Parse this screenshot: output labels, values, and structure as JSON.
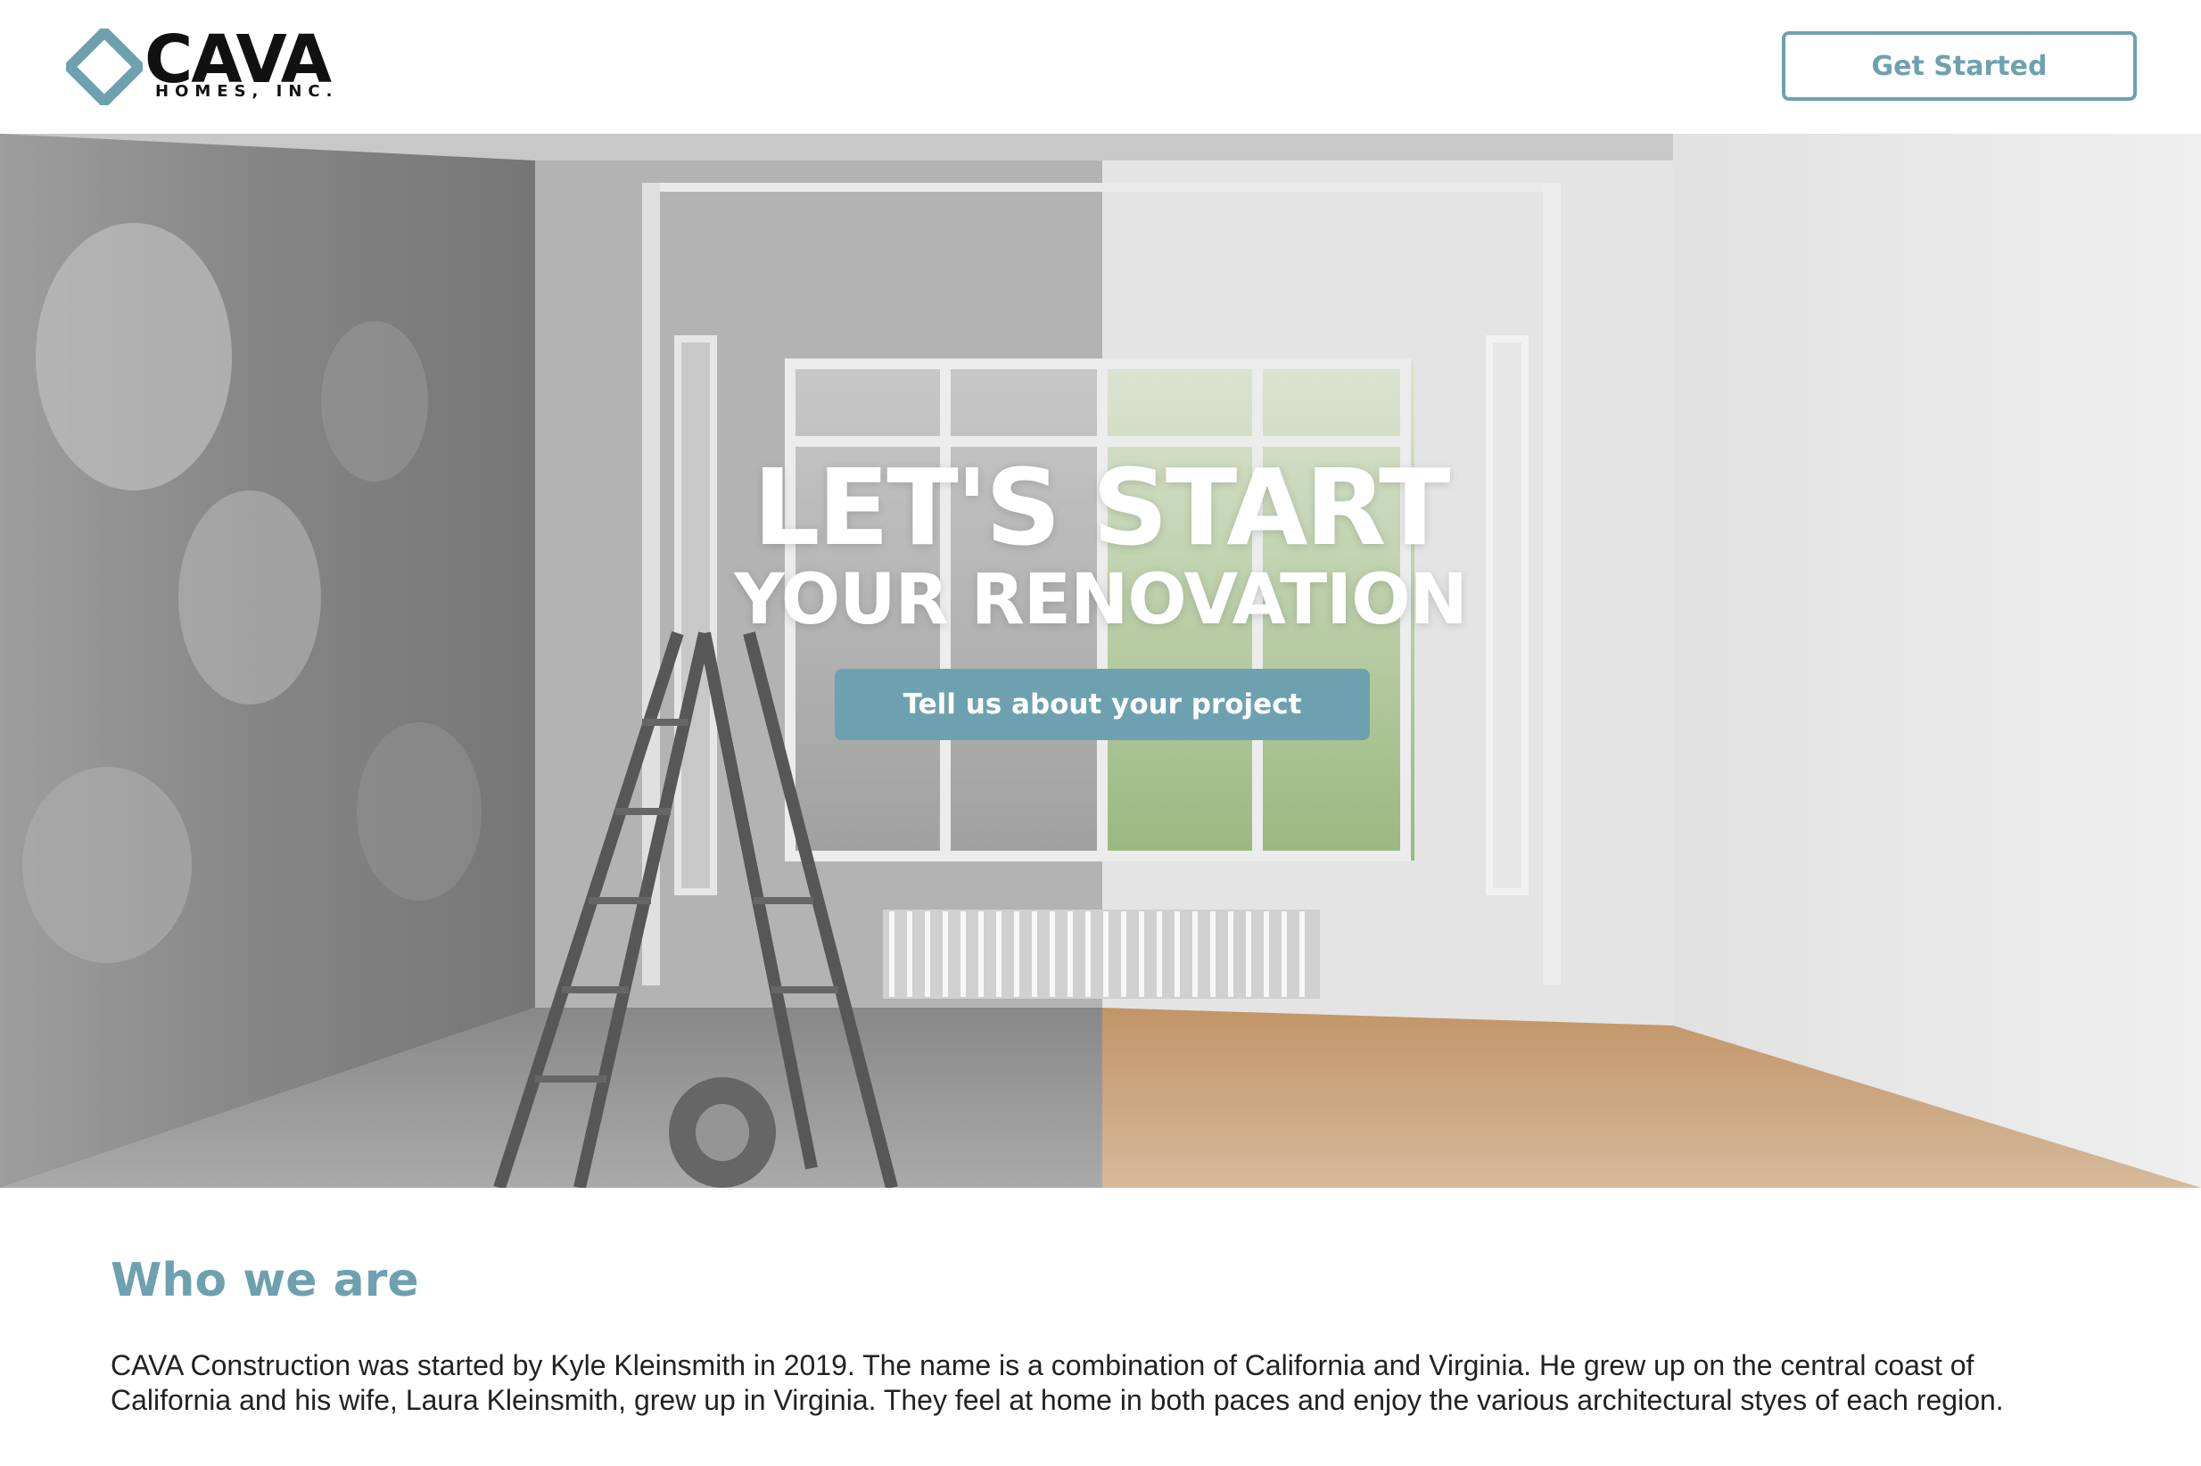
{
  "header": {
    "logo_name": "CAVA",
    "logo_tagline": "HOMES, INC.",
    "cta_label": "Get Started"
  },
  "hero": {
    "title": "LET'S START",
    "subtitle": "YOUR RENOVATION",
    "cta_label": "Tell us about your project",
    "image_description_icon": "renovation-before-after-photo"
  },
  "about": {
    "heading": "Who we are",
    "body": "CAVA Construction was started by Kyle Kleinsmith in 2019. The name is a combination of California and Virginia. He grew up on the central coast of California and his wife, Laura Kleinsmith, grew up in Virginia. They feel at home in both paces and enjoy the various architectural styes of each region."
  },
  "colors": {
    "accent": "#6ea1b0",
    "text": "#222222",
    "logo": "#111111"
  }
}
